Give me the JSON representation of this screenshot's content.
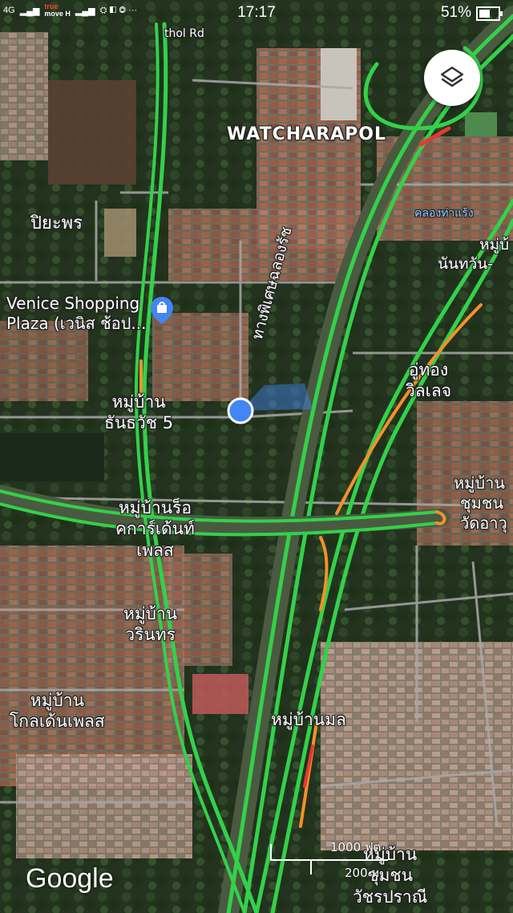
{
  "status_bar": {
    "network_label": "4G",
    "carrier_top": "true",
    "carrier_bottom": "move H",
    "time": "17:17",
    "battery": "51%"
  },
  "map": {
    "labels": {
      "road_top": "thol Rd",
      "watcharapol": "WATCHARAPOL",
      "piyaporn": "ปิยะพร",
      "venice_line1": "Venice Shopping",
      "venice_line2": "Plaza (เวนิส ช้อป...",
      "khlong": "คลองท่าแร้ง",
      "nantawan_line1": "หมู่บ้",
      "nantawan_line2": "นันทวัน-",
      "expressway": "ทางพิเศษฉลองรัช",
      "uthong_line1": "อู่ทอง",
      "uthong_line2": "วิลเลจ",
      "thanarat_line1": "หมู่บ้าน",
      "thanarat_line2": "ธันธวัช 5",
      "chumchon1_line1": "หมู่บ้าน",
      "chumchon1_line2": "ชุมชน",
      "chumchon1_line3": "วัดอาวุ",
      "rock_line1": "หมู่บ้านร็อ",
      "rock_line2": "คการ์เด้นท์",
      "rock_line3": "เพลส",
      "warin_line1": "หมู่บ้าน",
      "warin_line2": "วรินทร",
      "golden_line1": "หมู่บ้าน",
      "golden_line2": "โกลเด้นเพลส",
      "mon": "หมู่บ้านมล",
      "chumchon2_line1": "หมู่บ้าน",
      "chumchon2_line2": "ชุมชน",
      "chumchon2_line3": "วัชรปราณี"
    },
    "scale": {
      "feet": "1000 ฟุต",
      "meters": "200 ม."
    },
    "google_logo": "Google"
  },
  "colors": {
    "traffic_green": "#33d14a",
    "traffic_orange": "#f5902a",
    "traffic_red": "#e53935",
    "location_blue": "#4285f4"
  }
}
